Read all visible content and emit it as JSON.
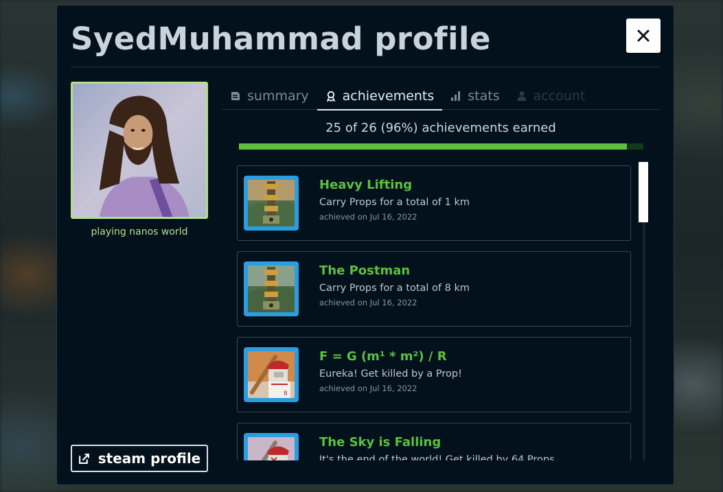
{
  "modal": {
    "title": "SyedMuhammad profile",
    "close_icon": "close-icon"
  },
  "profile": {
    "status": "playing nanos world",
    "steam_button": "steam profile",
    "avatar_border_color": "#b4e08a"
  },
  "tabs": [
    {
      "label": "summary",
      "icon": "document-icon",
      "state": "inactive"
    },
    {
      "label": "achievements",
      "icon": "award-icon",
      "state": "active"
    },
    {
      "label": "stats",
      "icon": "bar-chart-icon",
      "state": "inactive"
    },
    {
      "label": "account",
      "icon": "user-icon",
      "state": "disabled"
    }
  ],
  "achievements": {
    "summary_text": "25 of 26 (96%) achievements earned",
    "earned": 25,
    "total": 26,
    "progress": 0.96,
    "progress_color": "#5cc13f",
    "items": [
      {
        "name": "Heavy Lifting",
        "description": "Carry Props for a total of 1 km",
        "date": "achieved on Jul 16, 2022",
        "icon": "robot-stack-icon"
      },
      {
        "name": "The Postman",
        "description": "Carry Props for a total of 8 km",
        "date": "achieved on Jul 16, 2022",
        "icon": "robot-stack-icon"
      },
      {
        "name": "F = G (m¹ * m²) / R",
        "description": "Eureka! Get killed by a Prop!",
        "date": "achieved on Jul 16, 2022",
        "icon": "baseball-player-icon"
      },
      {
        "name": "The Sky is Falling",
        "description": "It's the end of the world! Get killed by 64 Props",
        "date": "",
        "icon": "baseball-player-icon"
      }
    ]
  }
}
